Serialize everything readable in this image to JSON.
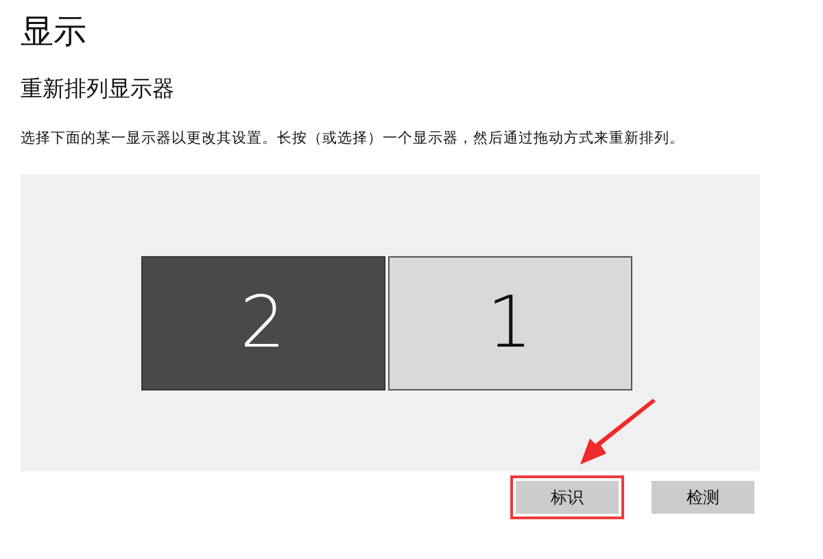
{
  "title": "显示",
  "section_title": "重新排列显示器",
  "description": "选择下面的某一显示器以更改其设置。长按（或选择）一个显示器，然后通过拖动方式来重新排列。",
  "monitors": [
    {
      "label": "2",
      "selected": true
    },
    {
      "label": "1",
      "selected": false
    }
  ],
  "buttons": [
    {
      "label": "标识",
      "highlighted": true
    },
    {
      "label": "检测",
      "highlighted": false
    }
  ]
}
